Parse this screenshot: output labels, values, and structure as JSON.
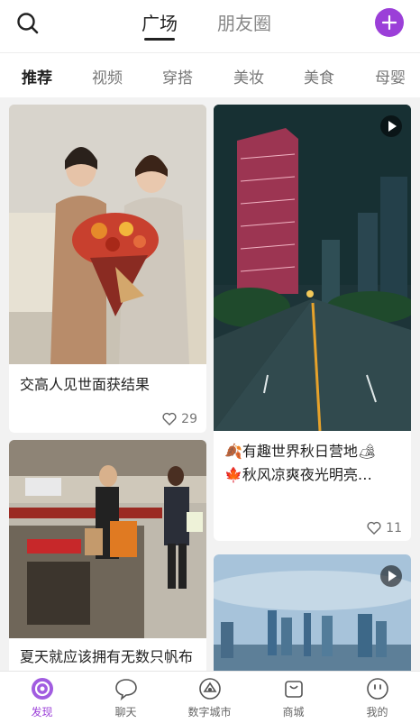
{
  "header": {
    "tabs": [
      {
        "label": "广场",
        "active": true
      },
      {
        "label": "朋友圈",
        "active": false
      }
    ],
    "accent_color": "#9b3fd8"
  },
  "categories": [
    "推荐",
    "视频",
    "穿搭",
    "美妆",
    "美食",
    "母婴"
  ],
  "feed": {
    "cards": [
      {
        "title": "交高人见世面获结果",
        "likes": "29",
        "video": false
      },
      {
        "title": "🍂有趣世界秋日营地🏕\n🍁秋风凉爽夜光明亮…",
        "likes": "11",
        "video": true
      },
      {
        "title": "夏天就应该拥有无数只帆布",
        "likes": "",
        "video": false
      },
      {
        "title": "",
        "likes": "",
        "video": true
      }
    ]
  },
  "bottom_nav": [
    {
      "label": "发现",
      "icon": "discover-icon",
      "active": true
    },
    {
      "label": "聊天",
      "icon": "chat-icon",
      "active": false
    },
    {
      "label": "数字城市",
      "icon": "digital-city-icon",
      "active": false
    },
    {
      "label": "商城",
      "icon": "mall-icon",
      "active": false
    },
    {
      "label": "我的",
      "icon": "profile-icon",
      "active": false
    }
  ]
}
